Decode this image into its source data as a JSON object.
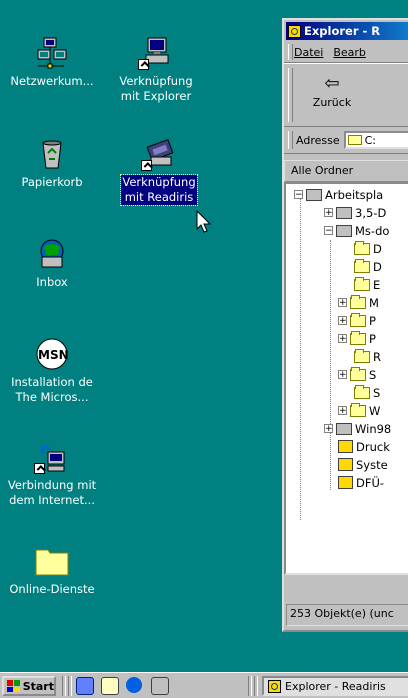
{
  "desktop": {
    "icons": [
      {
        "label_lines": [
          "Netzwerkum..."
        ]
      },
      {
        "label_lines": [
          "Verknüpfung",
          "mit Explorer"
        ]
      },
      {
        "label_lines": [
          "Papierkorb"
        ]
      },
      {
        "label_lines": [
          "Verknüpfung",
          "mit Readiris"
        ]
      },
      {
        "label_lines": [
          "Inbox"
        ]
      },
      {
        "label_lines": [
          "Installation de",
          "The Micros..."
        ]
      },
      {
        "label_lines": [
          "Verbindung mit",
          "dem Internet..."
        ]
      },
      {
        "label_lines": [
          "Online-Dienste"
        ]
      }
    ],
    "msn_logo_text": "MSN"
  },
  "explorer": {
    "title": "Explorer - R",
    "menu": [
      "Datei",
      "Bearb"
    ],
    "back_label": "Zurück",
    "address_label": "Adresse",
    "address_value": "C:",
    "pane_header": "Alle Ordner",
    "tree": [
      {
        "label": "Arbeitspla"
      },
      {
        "label": "3,5-D"
      },
      {
        "label": "Ms-do"
      },
      {
        "label": "D"
      },
      {
        "label": "D"
      },
      {
        "label": "E"
      },
      {
        "label": "M"
      },
      {
        "label": "P"
      },
      {
        "label": "P"
      },
      {
        "label": "R"
      },
      {
        "label": "S"
      },
      {
        "label": "S"
      },
      {
        "label": "W"
      },
      {
        "label": "Win98"
      },
      {
        "label": "Druck"
      },
      {
        "label": "Syste"
      },
      {
        "label": "DFÜ-"
      }
    ],
    "status": "253 Objekt(e) (unc"
  },
  "taskbar": {
    "start_label": "Start",
    "task_label": "Explorer - Readiris"
  },
  "colors": {
    "desktop": "#008080",
    "title_start": "#000080",
    "selection": "#000080"
  }
}
